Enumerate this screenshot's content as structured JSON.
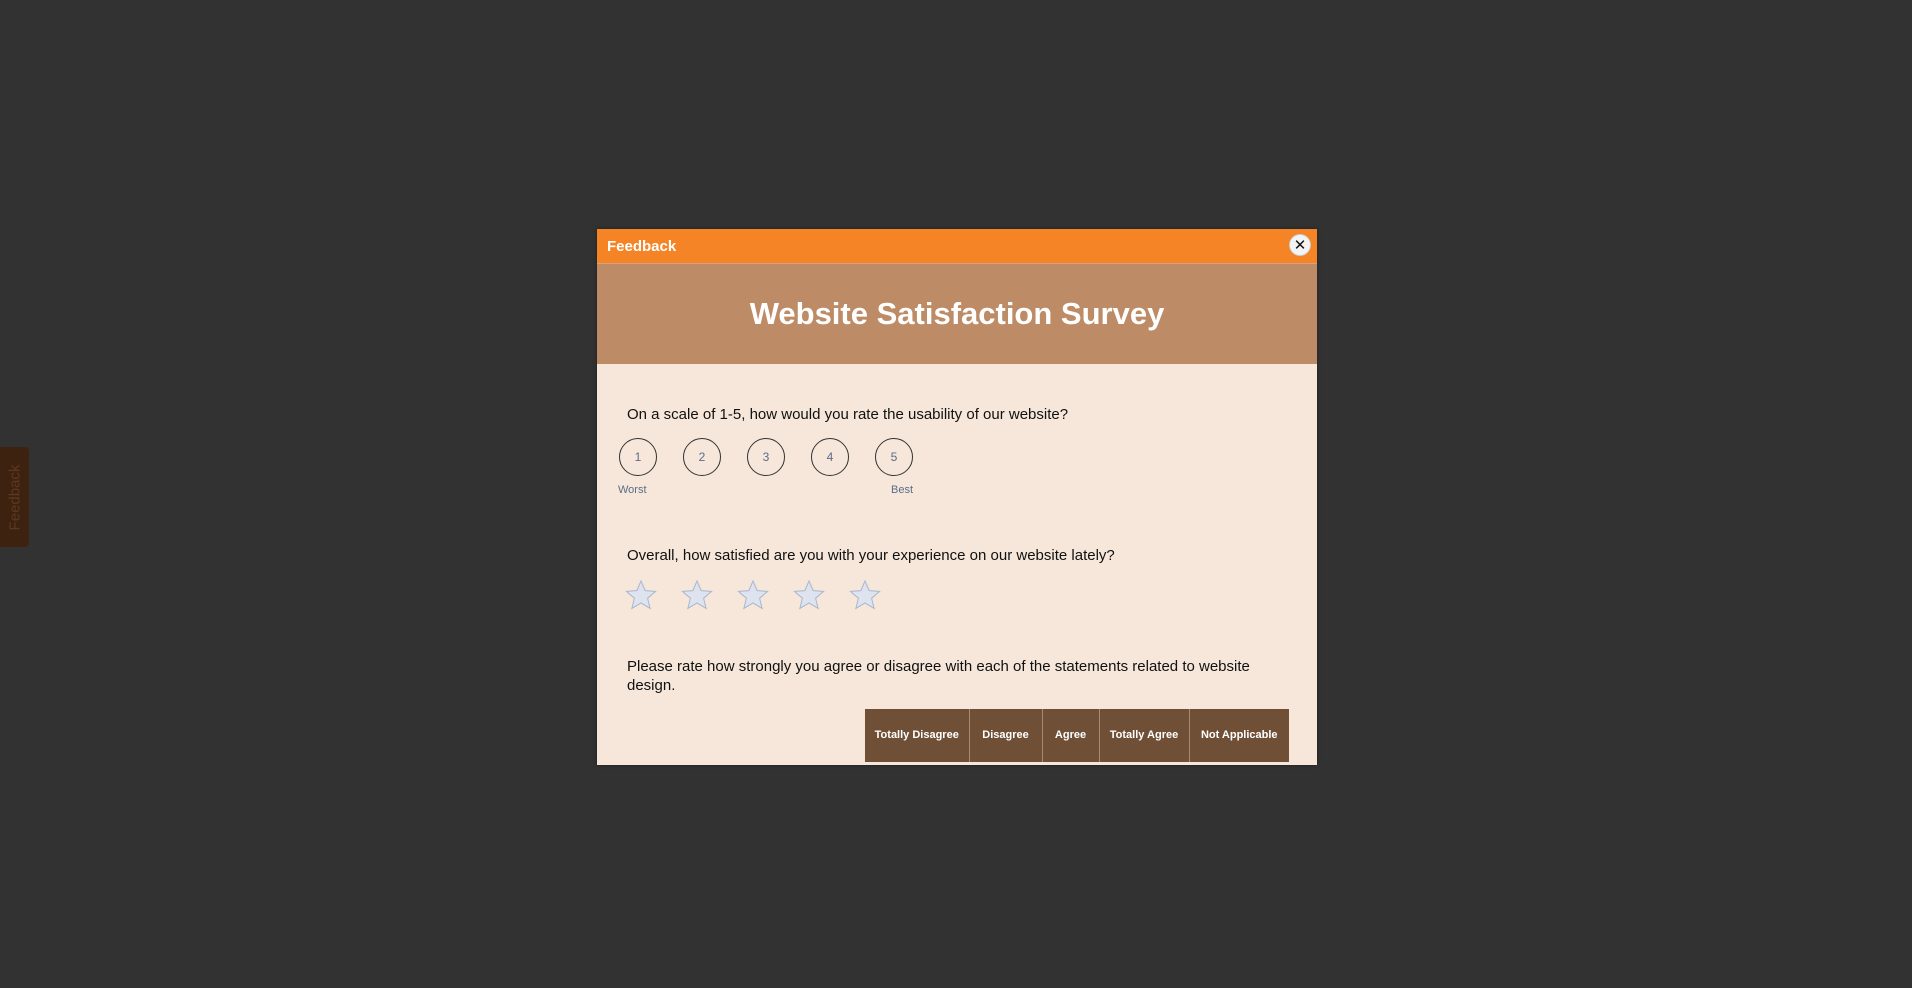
{
  "side_tab": {
    "label": "Feedback"
  },
  "modal": {
    "title": "Feedback",
    "close_icon": "close-icon",
    "close_label": "✕",
    "banner_title": "Website Satisfaction Survey"
  },
  "q1": {
    "text": "On a scale of 1-5, how would you rate the usability of our website?",
    "options": [
      "1",
      "2",
      "3",
      "4",
      "5"
    ],
    "low_label": "Worst",
    "high_label": "Best"
  },
  "q2": {
    "text": "Overall, how satisfied are you with your experience on our website lately?",
    "star_count": 5,
    "star_icon": "star-icon"
  },
  "q3": {
    "text": "Please rate how strongly you agree or disagree with each of the statements related to website design.",
    "columns": [
      "Totally Disagree",
      "Disagree",
      "Agree",
      "Totally Agree",
      "Not Applicable"
    ]
  },
  "colors": {
    "header": "#f58426",
    "banner": "#bd8b66",
    "body": "#f6e7da",
    "matrix_header": "#6f5037",
    "backdrop": "#323232"
  }
}
